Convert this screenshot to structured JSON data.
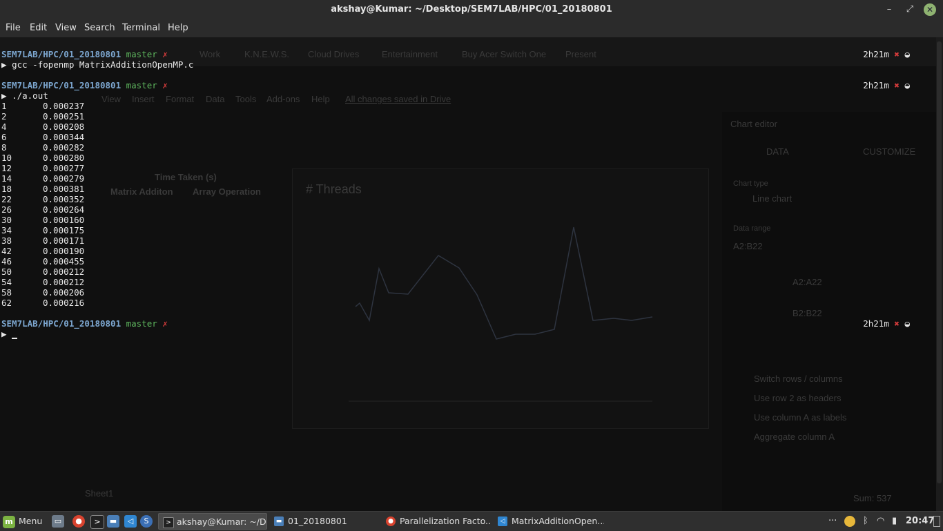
{
  "window": {
    "title": "akshay@Kumar: ~/Desktop/SEM7LAB/HPC/01_20180801",
    "minimize_glyph": "–",
    "maximize_glyph": "⤢",
    "close_glyph": "✕"
  },
  "menu": [
    "File",
    "Edit",
    "View",
    "Search",
    "Terminal",
    "Help"
  ],
  "terminal": {
    "prompt_path": "SEM7LAB/HPC/01_20180801",
    "branch": "master",
    "dirty_mark": "✗",
    "arrow": "▶",
    "elapsed": "2h21m",
    "status_x": "✖",
    "status_dot": "◒",
    "command1": "gcc -fopenmp MatrixAdditionOpenMP.c",
    "command2": "./a.out",
    "output": [
      [
        "1",
        "0.000237"
      ],
      [
        "2",
        "0.000251"
      ],
      [
        "4",
        "0.000208"
      ],
      [
        "6",
        "0.000344"
      ],
      [
        "8",
        "0.000282"
      ],
      [
        "10",
        "0.000280"
      ],
      [
        "12",
        "0.000277"
      ],
      [
        "14",
        "0.000279"
      ],
      [
        "18",
        "0.000381"
      ],
      [
        "22",
        "0.000352"
      ],
      [
        "26",
        "0.000264"
      ],
      [
        "30",
        "0.000160"
      ],
      [
        "34",
        "0.000175"
      ],
      [
        "38",
        "0.000171"
      ],
      [
        "42",
        "0.000190"
      ],
      [
        "46",
        "0.000455"
      ],
      [
        "50",
        "0.000212"
      ],
      [
        "54",
        "0.000212"
      ],
      [
        "58",
        "0.000206"
      ],
      [
        "62",
        "0.000216"
      ]
    ]
  },
  "background_ghost": {
    "bookmarks": [
      "Work",
      "K.N.E.W.S.",
      "Cloud Drives",
      "Entertainment",
      "Buy Acer Switch One",
      "Present"
    ],
    "sheet_menu": [
      "View",
      "Insert",
      "Format",
      "Data",
      "Tools",
      "Add-ons",
      "Help"
    ],
    "saved_status": "All changes saved in Drive",
    "column_header_time": "Time Taken (s)",
    "col_matrix": "Matrix Additon",
    "col_array": "Array Operation",
    "chart_title": "# Threads",
    "chart_editor_title": "Chart editor",
    "chart_editor_tabs": [
      "DATA",
      "CUSTOMIZE"
    ],
    "chart_type_label": "Chart type",
    "chart_type_value": "Line chart",
    "data_range_label": "Data range",
    "data_range_value": "A2:B22",
    "xaxis_value": "A2:A22",
    "series_value": "B2:B22",
    "checkboxes": [
      "Switch rows / columns",
      "Use row 2 as headers",
      "Use column A as labels",
      "Aggregate column A"
    ],
    "sheet_tab": "Sheet1",
    "sum_label": "Sum: 537"
  },
  "taskbar": {
    "menu_label": "Menu",
    "tasks": [
      {
        "label": "akshay@Kumar: ~/D...",
        "active": true
      },
      {
        "label": "01_20180801",
        "active": false
      },
      {
        "label": "Parallelization Facto...",
        "active": false
      },
      {
        "label": "MatrixAdditionOpen...",
        "active": false
      }
    ],
    "clock": "20:47",
    "tray_more": "···"
  },
  "colors": {
    "path": "#7ca6cf",
    "branch": "#5fb85f",
    "dirty": "#d33b3b",
    "terminal_bg": "#101010",
    "mint": "#7cb342"
  }
}
